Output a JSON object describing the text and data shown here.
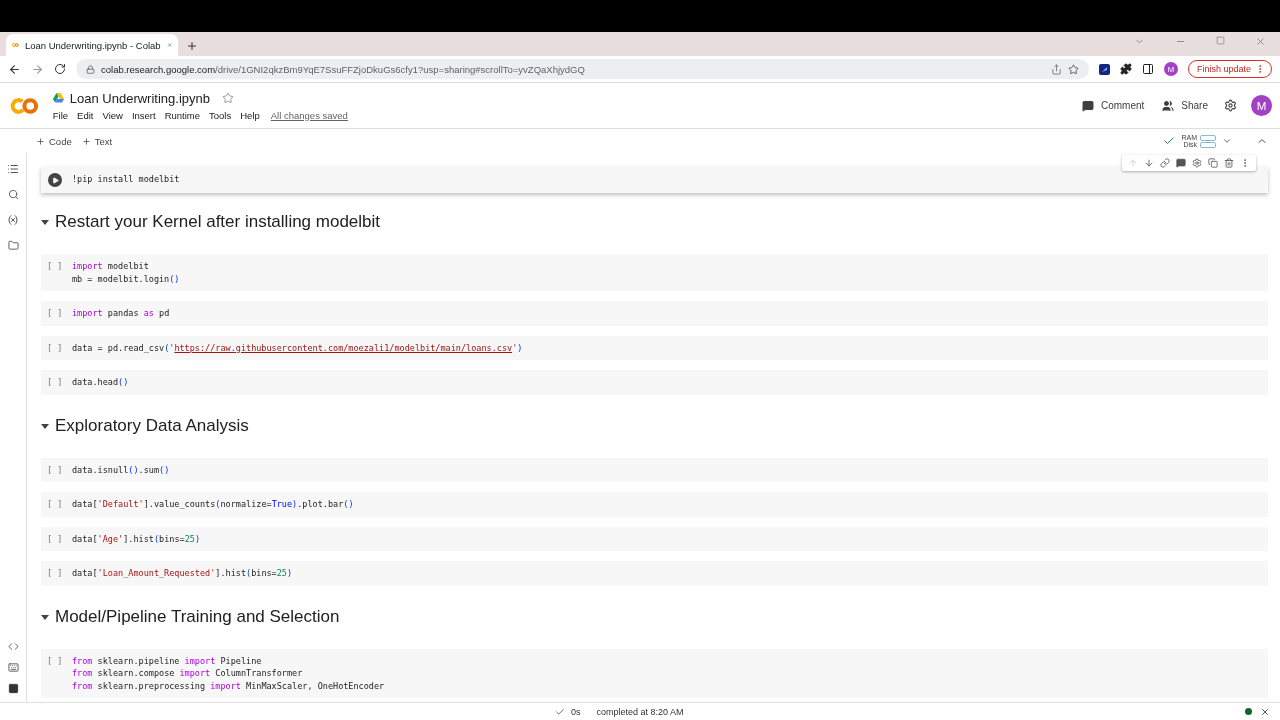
{
  "browser": {
    "tab_title": "Loan Underwriting.ipynb - Colab",
    "url_host": "colab.research.google.com",
    "url_path": "/drive/1GNI2qkzBm9YqE7SsuFFZjoDkuGs6cfy1?usp=sharing#scrollTo=yvZQaXhjydGQ",
    "profile": "M",
    "update_button": "Finish update"
  },
  "notebook": {
    "title": "Loan Underwriting.ipynb",
    "starred": false,
    "menu": [
      "File",
      "Edit",
      "View",
      "Insert",
      "Runtime",
      "Tools",
      "Help"
    ],
    "save_status": "All changes saved",
    "actions": [
      "Comment",
      "Share"
    ],
    "avatar": "M",
    "add_buttons": [
      "Code",
      "Text"
    ],
    "resources": [
      "RAM",
      "Disk"
    ],
    "connected": true
  },
  "cells": [
    {
      "kind": "code",
      "selected": true,
      "lines": [
        [
          {
            "t": "!pip install modelbit",
            "kind": "plain"
          }
        ]
      ]
    },
    {
      "kind": "heading",
      "expanded": true,
      "text": "Restart your Kernel after installing modelbit"
    },
    {
      "kind": "code",
      "selected": false,
      "prompt": "[ ]",
      "lines": [
        [
          {
            "t": "import",
            "kind": "kw"
          },
          {
            "t": " modelbit",
            "kind": "plain"
          }
        ],
        [
          {
            "t": "mb = modelbit.login",
            "kind": "plain"
          },
          {
            "t": "()",
            "kind": "paren"
          }
        ]
      ]
    },
    {
      "kind": "code",
      "selected": false,
      "prompt": "[ ]",
      "lines": [
        [
          {
            "t": "import",
            "kind": "kw"
          },
          {
            "t": " pandas ",
            "kind": "plain"
          },
          {
            "t": "as",
            "kind": "kw"
          },
          {
            "t": " pd",
            "kind": "plain"
          }
        ]
      ]
    },
    {
      "kind": "code",
      "selected": false,
      "prompt": "[ ]",
      "lines": [
        [
          {
            "t": "data = pd.read_csv",
            "kind": "plain"
          },
          {
            "t": "(",
            "kind": "paren"
          },
          {
            "t": "'",
            "kind": "str"
          },
          {
            "t": "https://raw.githubusercontent.com/moezali1/modelbit/main/loans.csv",
            "kind": "url"
          },
          {
            "t": "'",
            "kind": "str"
          },
          {
            "t": ")",
            "kind": "paren"
          }
        ]
      ]
    },
    {
      "kind": "code",
      "selected": false,
      "prompt": "[ ]",
      "lines": [
        [
          {
            "t": "data.head",
            "kind": "plain"
          },
          {
            "t": "()",
            "kind": "paren"
          }
        ]
      ]
    },
    {
      "kind": "heading",
      "expanded": true,
      "text": "Exploratory Data Analysis"
    },
    {
      "kind": "code",
      "selected": false,
      "prompt": "[ ]",
      "lines": [
        [
          {
            "t": "data.isnull",
            "kind": "plain"
          },
          {
            "t": "()",
            "kind": "paren"
          },
          {
            "t": ".sum",
            "kind": "plain"
          },
          {
            "t": "()",
            "kind": "paren"
          }
        ]
      ]
    },
    {
      "kind": "code",
      "selected": false,
      "prompt": "[ ]",
      "lines": [
        [
          {
            "t": "data[",
            "kind": "plain"
          },
          {
            "t": "'Default'",
            "kind": "str"
          },
          {
            "t": "].value_counts",
            "kind": "plain"
          },
          {
            "t": "(",
            "kind": "paren"
          },
          {
            "t": "normalize=",
            "kind": "plain"
          },
          {
            "t": "True",
            "kind": "const"
          },
          {
            "t": ")",
            "kind": "paren"
          },
          {
            "t": ".plot.bar",
            "kind": "plain"
          },
          {
            "t": "()",
            "kind": "paren"
          }
        ]
      ]
    },
    {
      "kind": "code",
      "selected": false,
      "prompt": "[ ]",
      "lines": [
        [
          {
            "t": "data[",
            "kind": "plain"
          },
          {
            "t": "'Age'",
            "kind": "str"
          },
          {
            "t": "].hist",
            "kind": "plain"
          },
          {
            "t": "(",
            "kind": "paren"
          },
          {
            "t": "bins=",
            "kind": "plain"
          },
          {
            "t": "25",
            "kind": "num"
          },
          {
            "t": ")",
            "kind": "paren"
          }
        ]
      ]
    },
    {
      "kind": "code",
      "selected": false,
      "prompt": "[ ]",
      "lines": [
        [
          {
            "t": "data[",
            "kind": "plain"
          },
          {
            "t": "'Loan_Amount_Requested'",
            "kind": "str"
          },
          {
            "t": "].hist",
            "kind": "plain"
          },
          {
            "t": "(",
            "kind": "paren"
          },
          {
            "t": "bins=",
            "kind": "plain"
          },
          {
            "t": "25",
            "kind": "num"
          },
          {
            "t": ")",
            "kind": "paren"
          }
        ]
      ]
    },
    {
      "kind": "heading",
      "expanded": true,
      "text": "Model/Pipeline Training and Selection"
    },
    {
      "kind": "code",
      "selected": false,
      "prompt": "[ ]",
      "lines": [
        [
          {
            "t": "from",
            "kind": "kw"
          },
          {
            "t": " sklearn.pipeline ",
            "kind": "plain"
          },
          {
            "t": "import",
            "kind": "kw"
          },
          {
            "t": " Pipeline",
            "kind": "plain"
          }
        ],
        [
          {
            "t": "from",
            "kind": "kw"
          },
          {
            "t": " sklearn.compose ",
            "kind": "plain"
          },
          {
            "t": "import",
            "kind": "kw"
          },
          {
            "t": " ColumnTransformer",
            "kind": "plain"
          }
        ],
        [
          {
            "t": "from",
            "kind": "kw"
          },
          {
            "t": " sklearn.preprocessing ",
            "kind": "plain"
          },
          {
            "t": "import",
            "kind": "kw"
          },
          {
            "t": " MinMaxScaler, OneHotEncoder",
            "kind": "plain"
          }
        ]
      ]
    }
  ],
  "status": {
    "duration": "0s",
    "message": "completed at 8:20 AM"
  }
}
